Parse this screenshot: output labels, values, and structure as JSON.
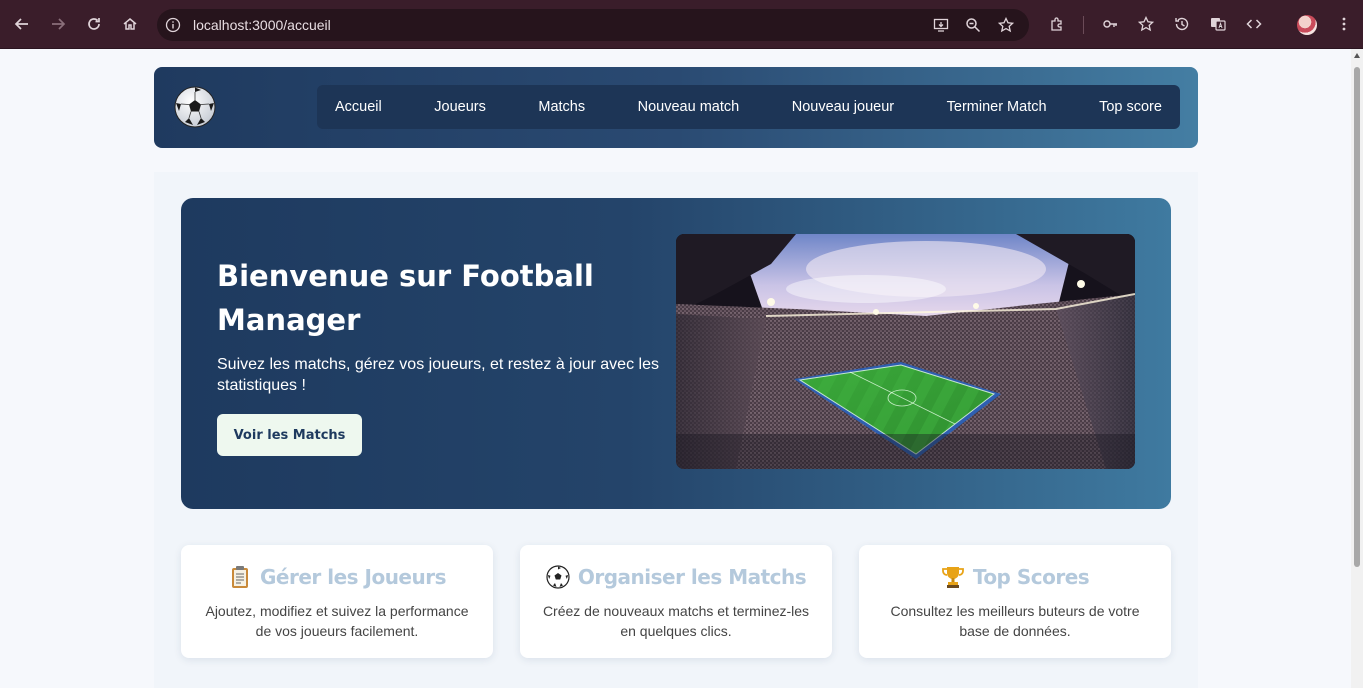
{
  "browser": {
    "url": "localhost:3000/accueil",
    "icons": [
      "back-icon",
      "forward-icon",
      "reload-icon",
      "home-icon",
      "site-info-icon",
      "install-icon",
      "zoom-icon",
      "bookmark-star-icon",
      "extensions-icon",
      "password-key-icon",
      "favorites-icon",
      "history-icon",
      "translate-icon",
      "devtools-icon",
      "profile-avatar",
      "menu-dots-icon"
    ]
  },
  "nav": {
    "logo": "soccer-ball-logo",
    "links": [
      "Accueil",
      "Joueurs",
      "Matchs",
      "Nouveau match",
      "Nouveau joueur",
      "Terminer Match",
      "Top score"
    ]
  },
  "hero": {
    "title": "Bienvenue sur Football Manager",
    "subtitle": "Suivez les matchs, gérez vos joueurs, et restez à jour avec les statistiques !",
    "button": "Voir les Matchs",
    "image": "stadium-photo"
  },
  "cards": [
    {
      "icon": "clipboard-icon",
      "title": "Gérer les Joueurs",
      "desc": "Ajoutez, modifiez et suivez la performance de vos joueurs facilement."
    },
    {
      "icon": "soccer-ball-icon",
      "title": "Organiser les Matchs",
      "desc": "Créez de nouveaux matchs et terminez-les en quelques clics."
    },
    {
      "icon": "trophy-icon",
      "title": "Top Scores",
      "desc": "Consultez les meilleurs buteurs de votre base de données."
    }
  ],
  "colors": {
    "chrome": "#3a1d2a",
    "navy": "#1e3a5f",
    "steel_blue": "#447ea3",
    "card_title": "#b4c9dc",
    "button_bg": "#eef8ef"
  }
}
